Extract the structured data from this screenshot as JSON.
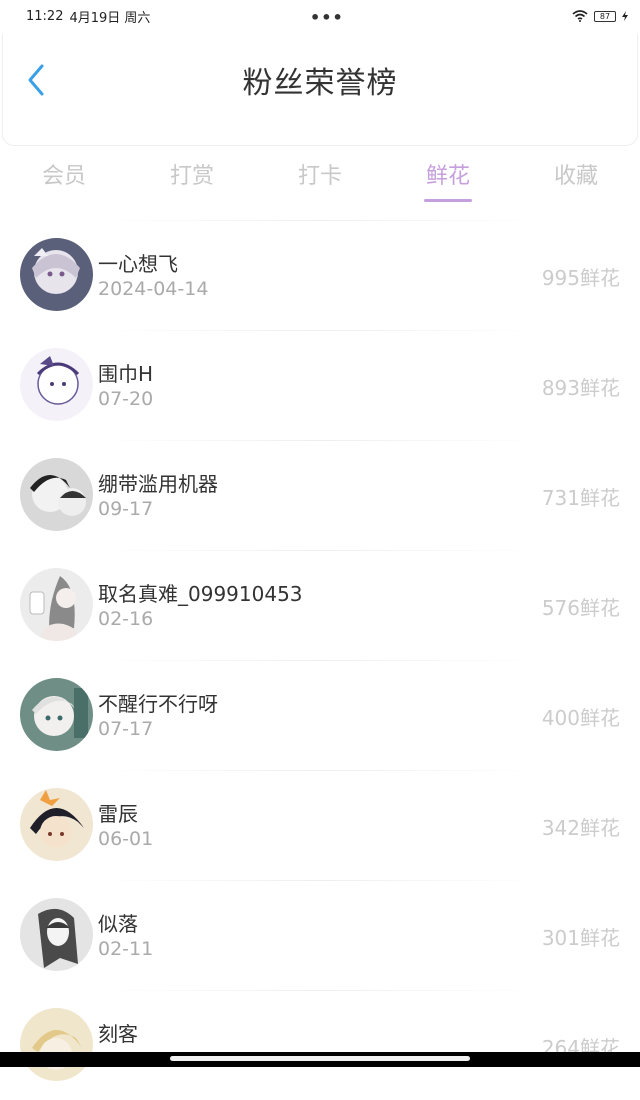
{
  "status_bar": {
    "time": "11:22",
    "date": "4月19日 周六",
    "battery": "87"
  },
  "header": {
    "title": "粉丝荣誉榜"
  },
  "tabs": [
    {
      "label": "会员"
    },
    {
      "label": "打赏"
    },
    {
      "label": "打卡"
    },
    {
      "label": "鲜花",
      "active": true
    },
    {
      "label": "收藏"
    }
  ],
  "fans": [
    {
      "name": "一心想飞",
      "date": "2024-04-14",
      "amount": "995鲜花"
    },
    {
      "name": "围巾H",
      "date": "07-20",
      "amount": "893鲜花"
    },
    {
      "name": "绷带滥用机器",
      "date": "09-17",
      "amount": "731鲜花"
    },
    {
      "name": "取名真难_099910453",
      "date": "02-16",
      "amount": "576鲜花"
    },
    {
      "name": "不醒行不行呀",
      "date": "07-17",
      "amount": "400鲜花"
    },
    {
      "name": "雷辰",
      "date": "06-01",
      "amount": "342鲜花"
    },
    {
      "name": "似落",
      "date": "02-11",
      "amount": "301鲜花"
    },
    {
      "name": "刻客",
      "date": "",
      "amount": "264鲜花"
    }
  ],
  "colors": {
    "accent": "#c6a0dc",
    "back_arrow": "#3aa0e6",
    "inactive_tab": "#c8c8c8",
    "amount_text": "#cccccc"
  }
}
